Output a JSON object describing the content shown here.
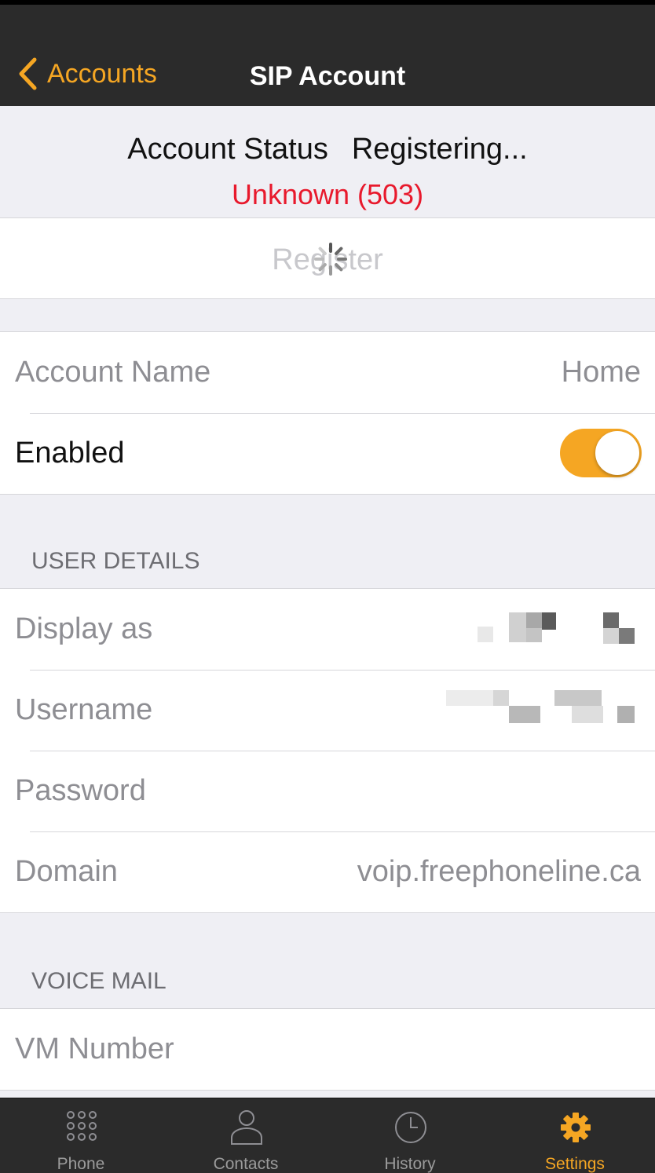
{
  "nav": {
    "back_label": "Accounts",
    "title": "SIP Account"
  },
  "status": {
    "label": "Account Status",
    "value": "Registering...",
    "error": "Unknown (503)"
  },
  "register": {
    "label": "Register"
  },
  "account": {
    "name_label": "Account Name",
    "name_value": "Home",
    "enabled_label": "Enabled",
    "enabled": true
  },
  "user_details": {
    "header": "USER DETAILS",
    "display_label": "Display as",
    "username_label": "Username",
    "password_label": "Password",
    "domain_label": "Domain",
    "domain_value": "voip.freephoneline.ca"
  },
  "voicemail": {
    "header": "VOICE MAIL",
    "vm_label": "VM Number"
  },
  "tabs": [
    {
      "label": "Phone",
      "icon": "keypad-icon"
    },
    {
      "label": "Contacts",
      "icon": "person-icon"
    },
    {
      "label": "History",
      "icon": "clock-icon"
    },
    {
      "label": "Settings",
      "icon": "gear-icon"
    }
  ],
  "colors": {
    "accent": "#f5a623",
    "error": "#e8192c",
    "bar": "#2b2b2b"
  }
}
